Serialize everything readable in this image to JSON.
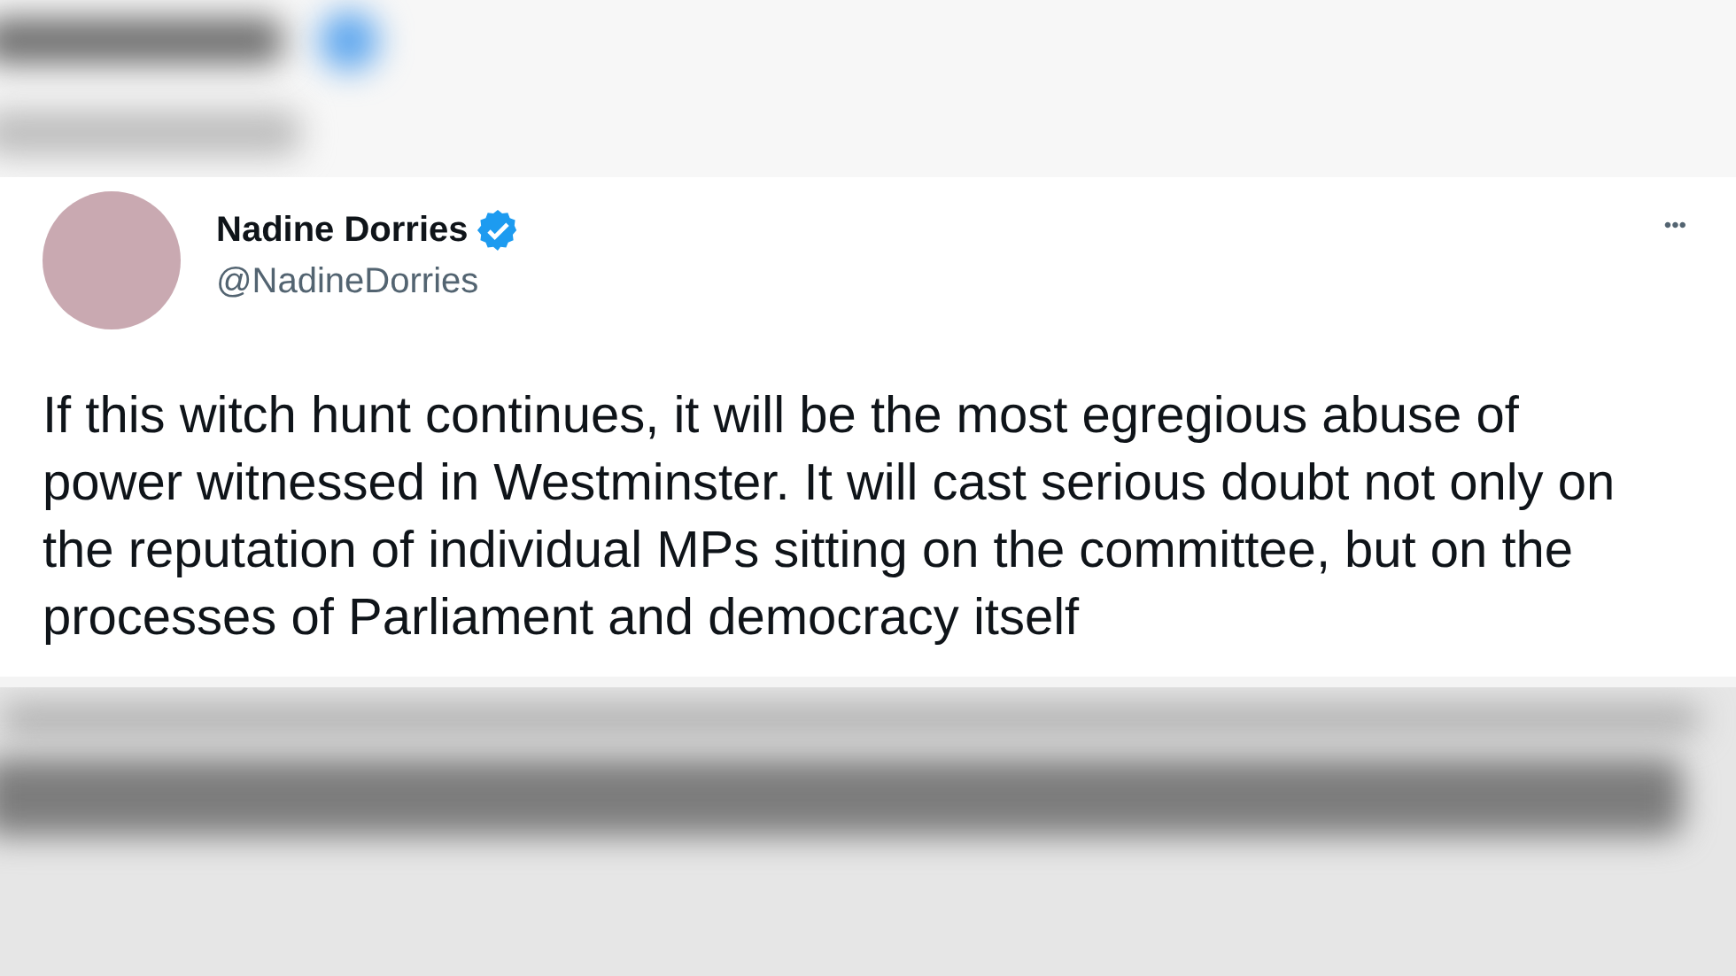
{
  "tweet": {
    "author": {
      "name": "Nadine Dorries",
      "handle": "@NadineDorries",
      "verified": true
    },
    "more": "•••",
    "text": "If this witch hunt continues, it will be the most egregious abuse of power witnessed in Westminster. It will cast serious doubt not only on the reputation of individual MPs sitting on the committee, but on the processes of Parliament and democracy itself"
  }
}
